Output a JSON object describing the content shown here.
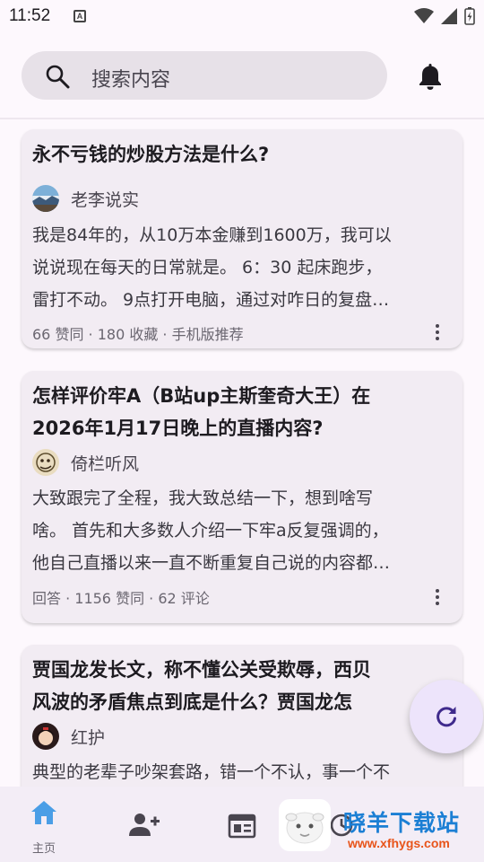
{
  "status_bar": {
    "time": "11:52",
    "notification_badge": "A"
  },
  "search": {
    "placeholder": "搜索内容",
    "icon": "search-icon",
    "notification_icon": "bell-icon"
  },
  "feed": {
    "cards": [
      {
        "title": "永不亏钱的炒股方法是什么?",
        "author": "老李说实",
        "excerpt_lines": [
          "我是84年的，从10万本金赚到1600万，我可以",
          "说说现在每天的日常就是。 6：30 起床跑步，",
          "雷打不动。 9点打开电脑，通过对咋日的复盘…"
        ],
        "meta": "66 赞同 · 180 收藏 · 手机版推荐"
      },
      {
        "title_lines": [
          "怎样评价牢A（B站up主斯奎奇大王）在",
          "2026年1月17日晚上的直播内容?"
        ],
        "author": "倚栏听风",
        "excerpt_lines": [
          "大致跟完了全程，我大致总结一下，想到啥写",
          "啥。 首先和大多数人介绍一下牢a反复强调的，",
          "他自己直播以来一直不断重复自己说的内容都…"
        ],
        "meta": "回答 · 1156 赞同 · 62 评论"
      },
      {
        "title_lines": [
          "贾国龙发长文，称不懂公关受欺辱，西贝",
          "风波的矛盾焦点到底是什么？贾国龙怎"
        ],
        "author": "红护",
        "excerpt_lines": [
          "典型的老辈子吵架套路，错一个不认，事一个不"
        ]
      }
    ]
  },
  "fab": {
    "icon": "refresh-icon"
  },
  "bottom_nav": {
    "items": [
      {
        "label": "主页",
        "icon": "home-icon",
        "active": true
      },
      {
        "label": "",
        "icon": "add-person-icon"
      },
      {
        "label": "",
        "icon": "newspaper-icon"
      },
      {
        "label": "",
        "icon": "history-icon"
      }
    ]
  },
  "watermark": {
    "text": "晓羊下载站",
    "url": "www.xfhygs.com"
  },
  "colors": {
    "background": "#fdf8fd",
    "card": "#f2ecf3",
    "search_bar": "#e7e1e8",
    "fab": "#ede4fb",
    "accent": "#5b3fb5",
    "active_nav": "#4a9ee6",
    "watermark_blue": "#1b7fd4",
    "watermark_orange": "#e8541a"
  }
}
